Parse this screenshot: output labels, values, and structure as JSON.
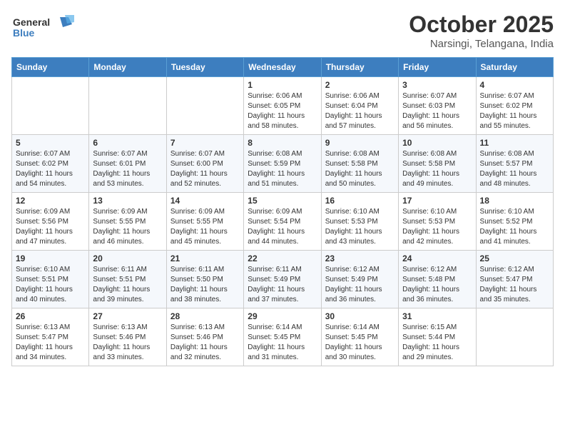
{
  "header": {
    "logo_general": "General",
    "logo_blue": "Blue",
    "month": "October 2025",
    "location": "Narsingi, Telangana, India"
  },
  "weekdays": [
    "Sunday",
    "Monday",
    "Tuesday",
    "Wednesday",
    "Thursday",
    "Friday",
    "Saturday"
  ],
  "weeks": [
    [
      {
        "day": "",
        "info": ""
      },
      {
        "day": "",
        "info": ""
      },
      {
        "day": "",
        "info": ""
      },
      {
        "day": "1",
        "info": "Sunrise: 6:06 AM\nSunset: 6:05 PM\nDaylight: 11 hours\nand 58 minutes."
      },
      {
        "day": "2",
        "info": "Sunrise: 6:06 AM\nSunset: 6:04 PM\nDaylight: 11 hours\nand 57 minutes."
      },
      {
        "day": "3",
        "info": "Sunrise: 6:07 AM\nSunset: 6:03 PM\nDaylight: 11 hours\nand 56 minutes."
      },
      {
        "day": "4",
        "info": "Sunrise: 6:07 AM\nSunset: 6:02 PM\nDaylight: 11 hours\nand 55 minutes."
      }
    ],
    [
      {
        "day": "5",
        "info": "Sunrise: 6:07 AM\nSunset: 6:02 PM\nDaylight: 11 hours\nand 54 minutes."
      },
      {
        "day": "6",
        "info": "Sunrise: 6:07 AM\nSunset: 6:01 PM\nDaylight: 11 hours\nand 53 minutes."
      },
      {
        "day": "7",
        "info": "Sunrise: 6:07 AM\nSunset: 6:00 PM\nDaylight: 11 hours\nand 52 minutes."
      },
      {
        "day": "8",
        "info": "Sunrise: 6:08 AM\nSunset: 5:59 PM\nDaylight: 11 hours\nand 51 minutes."
      },
      {
        "day": "9",
        "info": "Sunrise: 6:08 AM\nSunset: 5:58 PM\nDaylight: 11 hours\nand 50 minutes."
      },
      {
        "day": "10",
        "info": "Sunrise: 6:08 AM\nSunset: 5:58 PM\nDaylight: 11 hours\nand 49 minutes."
      },
      {
        "day": "11",
        "info": "Sunrise: 6:08 AM\nSunset: 5:57 PM\nDaylight: 11 hours\nand 48 minutes."
      }
    ],
    [
      {
        "day": "12",
        "info": "Sunrise: 6:09 AM\nSunset: 5:56 PM\nDaylight: 11 hours\nand 47 minutes."
      },
      {
        "day": "13",
        "info": "Sunrise: 6:09 AM\nSunset: 5:55 PM\nDaylight: 11 hours\nand 46 minutes."
      },
      {
        "day": "14",
        "info": "Sunrise: 6:09 AM\nSunset: 5:55 PM\nDaylight: 11 hours\nand 45 minutes."
      },
      {
        "day": "15",
        "info": "Sunrise: 6:09 AM\nSunset: 5:54 PM\nDaylight: 11 hours\nand 44 minutes."
      },
      {
        "day": "16",
        "info": "Sunrise: 6:10 AM\nSunset: 5:53 PM\nDaylight: 11 hours\nand 43 minutes."
      },
      {
        "day": "17",
        "info": "Sunrise: 6:10 AM\nSunset: 5:53 PM\nDaylight: 11 hours\nand 42 minutes."
      },
      {
        "day": "18",
        "info": "Sunrise: 6:10 AM\nSunset: 5:52 PM\nDaylight: 11 hours\nand 41 minutes."
      }
    ],
    [
      {
        "day": "19",
        "info": "Sunrise: 6:10 AM\nSunset: 5:51 PM\nDaylight: 11 hours\nand 40 minutes."
      },
      {
        "day": "20",
        "info": "Sunrise: 6:11 AM\nSunset: 5:51 PM\nDaylight: 11 hours\nand 39 minutes."
      },
      {
        "day": "21",
        "info": "Sunrise: 6:11 AM\nSunset: 5:50 PM\nDaylight: 11 hours\nand 38 minutes."
      },
      {
        "day": "22",
        "info": "Sunrise: 6:11 AM\nSunset: 5:49 PM\nDaylight: 11 hours\nand 37 minutes."
      },
      {
        "day": "23",
        "info": "Sunrise: 6:12 AM\nSunset: 5:49 PM\nDaylight: 11 hours\nand 36 minutes."
      },
      {
        "day": "24",
        "info": "Sunrise: 6:12 AM\nSunset: 5:48 PM\nDaylight: 11 hours\nand 36 minutes."
      },
      {
        "day": "25",
        "info": "Sunrise: 6:12 AM\nSunset: 5:47 PM\nDaylight: 11 hours\nand 35 minutes."
      }
    ],
    [
      {
        "day": "26",
        "info": "Sunrise: 6:13 AM\nSunset: 5:47 PM\nDaylight: 11 hours\nand 34 minutes."
      },
      {
        "day": "27",
        "info": "Sunrise: 6:13 AM\nSunset: 5:46 PM\nDaylight: 11 hours\nand 33 minutes."
      },
      {
        "day": "28",
        "info": "Sunrise: 6:13 AM\nSunset: 5:46 PM\nDaylight: 11 hours\nand 32 minutes."
      },
      {
        "day": "29",
        "info": "Sunrise: 6:14 AM\nSunset: 5:45 PM\nDaylight: 11 hours\nand 31 minutes."
      },
      {
        "day": "30",
        "info": "Sunrise: 6:14 AM\nSunset: 5:45 PM\nDaylight: 11 hours\nand 30 minutes."
      },
      {
        "day": "31",
        "info": "Sunrise: 6:15 AM\nSunset: 5:44 PM\nDaylight: 11 hours\nand 29 minutes."
      },
      {
        "day": "",
        "info": ""
      }
    ]
  ]
}
